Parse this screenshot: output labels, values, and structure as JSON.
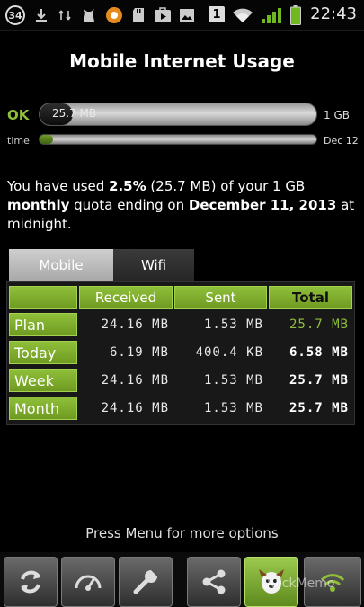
{
  "status_bar": {
    "badge_count": "34",
    "notification_num": "1",
    "time": "22:43"
  },
  "title": "Mobile Internet Usage",
  "usage": {
    "status": "OK",
    "used_label": "25.7 MB",
    "cap_label": "1 GB",
    "used_fraction": 0.025,
    "time_label": "time",
    "time_end_label": "Dec 12",
    "time_fraction": 0.05
  },
  "summary": {
    "t1": "You have used ",
    "pct": "2.5%",
    "t2": " (25.7 MB) of your 1 GB ",
    "period": "monthly",
    "t3": " quota ending on ",
    "end_date": "December 11, 2013",
    "t4": " at midnight."
  },
  "tabs": [
    {
      "label": "Mobile"
    },
    {
      "label": "Wifi"
    }
  ],
  "table": {
    "headers": [
      "Received",
      "Sent",
      "Total"
    ],
    "rows": [
      {
        "label": "Plan",
        "received": "24.16 MB",
        "sent": "1.53 MB",
        "total": "25.7 MB"
      },
      {
        "label": "Today",
        "received": "6.19 MB",
        "sent": "400.4 KB",
        "total": "6.58 MB"
      },
      {
        "label": "Week",
        "received": "24.16 MB",
        "sent": "1.53 MB",
        "total": "25.7 MB"
      },
      {
        "label": "Month",
        "received": "24.16 MB",
        "sent": "1.53 MB",
        "total": "25.7 MB"
      }
    ]
  },
  "footer": {
    "hint": "Press Menu for more options",
    "memo_label": "QuickMemo"
  },
  "toolbar_icons": [
    "refresh-icon",
    "speedometer-icon",
    "wrench-icon",
    "share-icon",
    "app-mascot-icon",
    "wifi-icon"
  ],
  "colors": {
    "accent": "#8fbf3a",
    "background": "#000000"
  }
}
